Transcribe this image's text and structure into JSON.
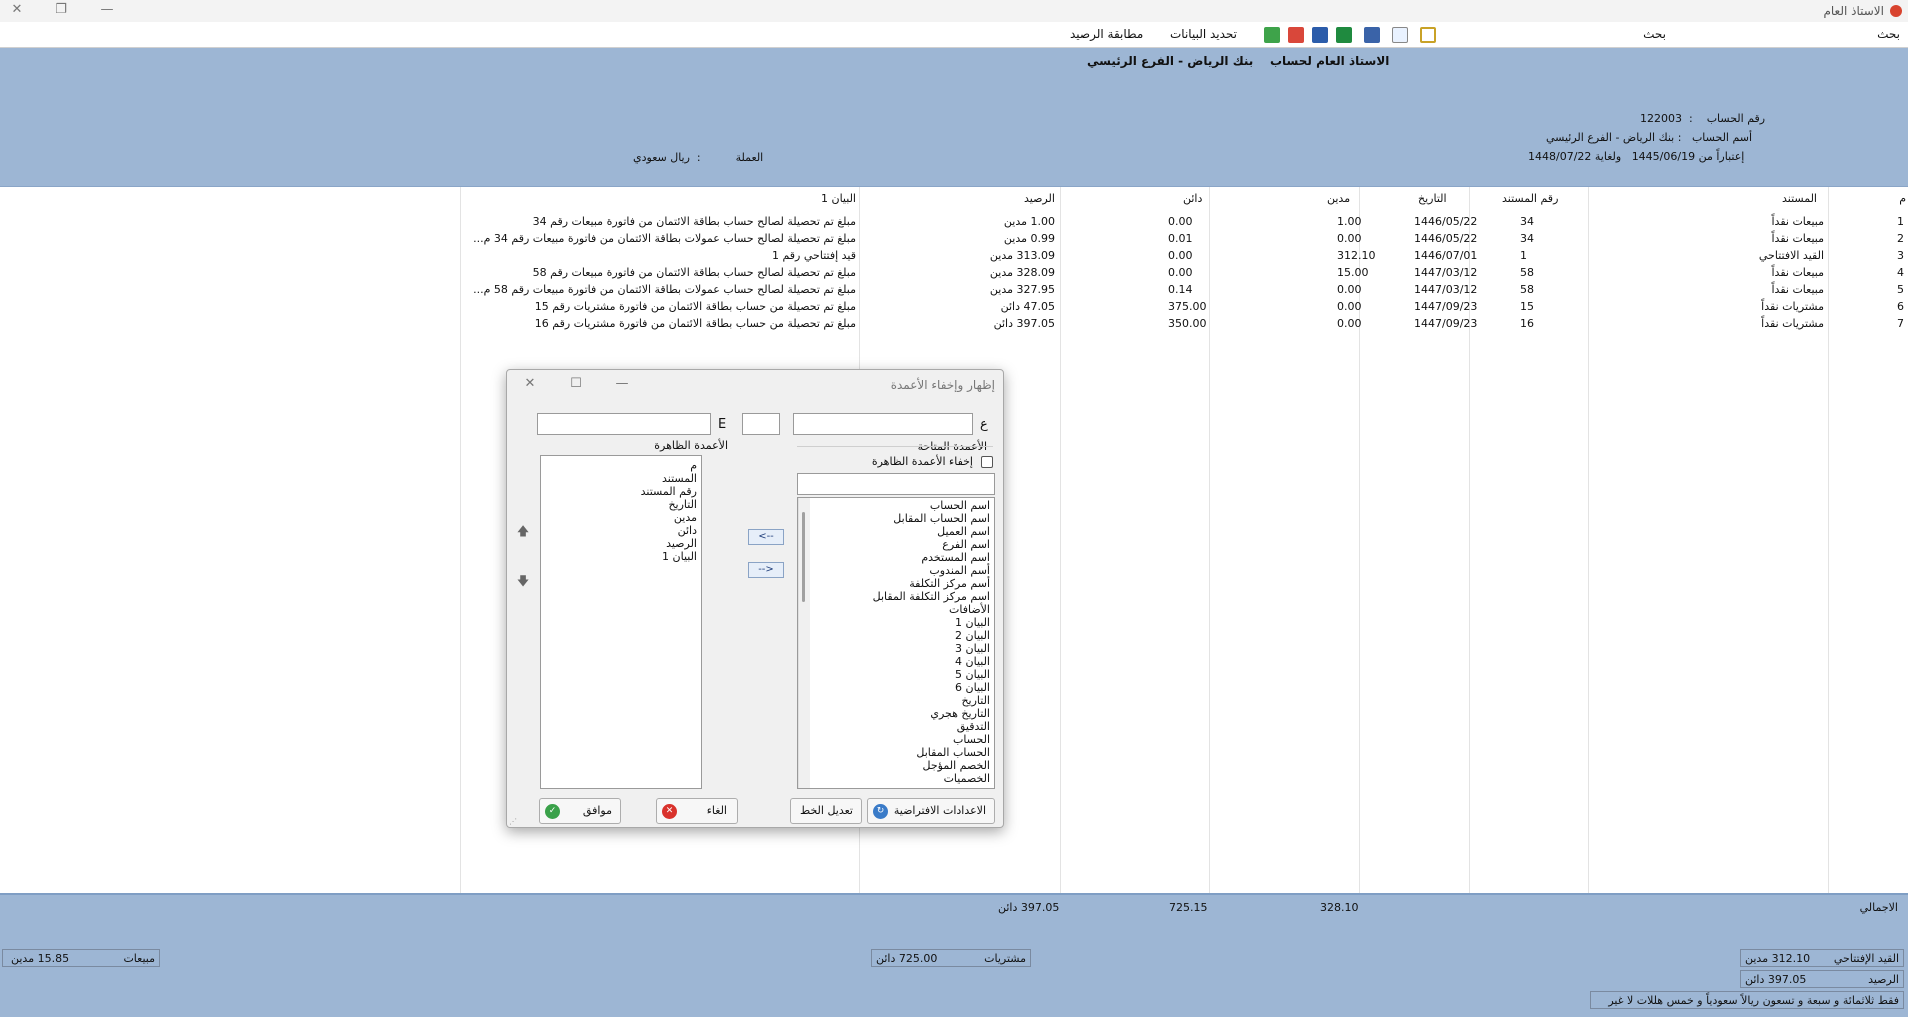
{
  "window": {
    "title": "الاستاذ العام"
  },
  "toolbar": {
    "search_left": "بحث",
    "search_right": "بحث",
    "refresh_data": "تحديد البيانات",
    "match_balance": "مطابقة الرصيد"
  },
  "header": {
    "report_title": "الاستاذ العام لحساب",
    "account_title_name": "بنك الرياض - الفرع الرئيسي",
    "account_no_label": "رقم الحساب",
    "account_no": "122003",
    "account_name_label": "أسم الحساب",
    "account_name": "بنك الرياض - الفرع الرئيسي",
    "from_label": "إعتباراً من",
    "from_date": "1445/06/19",
    "to_label": "ولغاية",
    "to_date": "1448/07/22",
    "currency_label": "العملة",
    "currency": "ريال سعودي"
  },
  "table": {
    "columns": [
      "م",
      "المستند",
      "رقم المستند",
      "التاريخ",
      "مدين",
      "دائن",
      "الرصيد",
      "البيان 1"
    ],
    "rows": [
      [
        "1",
        "مبيعات نقداً",
        "34",
        "1446/05/22",
        "1.00",
        "0.00",
        "1.00 مدين",
        "مبلغ تم تحصيلة لصالح حساب بطاقة الائتمان  من فاتورة مبيعات رقم  34"
      ],
      [
        "2",
        "مبيعات نقداً",
        "34",
        "1446/05/22",
        "0.00",
        "0.01",
        "0.99 مدين",
        "مبلغ تم تحصيلة لصالح حساب عمولات بطاقة الائتمان  من فاتورة مبيعات رقم  34  م..."
      ],
      [
        "3",
        "القيد الافتتاحي",
        "1",
        "1446/07/01",
        "312.10",
        "0.00",
        "313.09 مدين",
        "قيد إفتتاحي  رقم  1"
      ],
      [
        "4",
        "مبيعات نقداً",
        "58",
        "1447/03/12",
        "15.00",
        "0.00",
        "328.09 مدين",
        "مبلغ تم تحصيلة لصالح حساب بطاقة الائتمان  من فاتورة مبيعات رقم  58"
      ],
      [
        "5",
        "مبيعات نقداً",
        "58",
        "1447/03/12",
        "0.00",
        "0.14",
        "327.95 مدين",
        "مبلغ تم تحصيلة لصالح حساب عمولات بطاقة الائتمان  من فاتورة مبيعات رقم  58  م..."
      ],
      [
        "6",
        "مشتريات نقداً",
        "15",
        "1447/09/23",
        "0.00",
        "375.00",
        "47.05 دائن",
        "مبلغ تم تحصيلة من حساب بطاقة الائتمان  من فاتورة مشتريات رقم  15"
      ],
      [
        "7",
        "مشتريات نقداً",
        "16",
        "1447/09/23",
        "0.00",
        "350.00",
        "397.05 دائن",
        "مبلغ تم تحصيلة من حساب بطاقة الائتمان  من فاتورة مشتريات رقم  16"
      ]
    ]
  },
  "totals": {
    "label": "الاجمالي",
    "debit": "328.10",
    "credit": "725.15",
    "balance": "397.05 دائن",
    "opening_label": "القيد الإفتتاحي",
    "opening_value": "312.10  مدين",
    "balance_label": "الرصيد",
    "balance_value": "397.05  دائن",
    "purchases_label": "مشتريات",
    "purchases_value": "725.00  دائن",
    "sales_label": "مبيعات",
    "sales_value": "15.85  مدين",
    "amount_words": "فقط ثلاثمائة و سبعة و تسعون ريالاً سعودياً و خمس هللات لا غير"
  },
  "dialog": {
    "title": "إظهار وإخفاء الأعمدة",
    "search_glyph": "ع",
    "search_glyph2": "E",
    "available_label": "الأعمدة المتاحة",
    "hide_visible_label": "إخفاء الأعمدة الظاهرة",
    "visible_label": "الأعمدة الظاهرة",
    "available_items": [
      "اسم الحساب",
      "اسم الحساب المقابل",
      "اسم العميل",
      "اسم الفرع",
      "اسم المستخدم",
      "أسم المندوب",
      "أسم مركز التكلفة",
      "اسم مركز التكلفة المقابل",
      "الأضافات",
      "البيان 1",
      "البيان 2",
      "البيان 3",
      "البيان 4",
      "البيان 5",
      "البيان 6",
      "التاريخ",
      "التاريخ هجري",
      "التدقيق",
      "الحساب",
      "الحساب المقابل",
      "الخصم المؤجل",
      "الخصميات"
    ],
    "visible_items": [
      "م",
      "المستند",
      "رقم المستند",
      "التاريخ",
      "مدين",
      "دائن",
      "الرصيد",
      "البيان 1"
    ],
    "move_left": "<--",
    "move_right": "-->",
    "btn_defaults": "الاعدادات الافتراضية",
    "btn_font": "تعديل الخط",
    "btn_cancel": "الغاء",
    "btn_ok": "موافق"
  }
}
